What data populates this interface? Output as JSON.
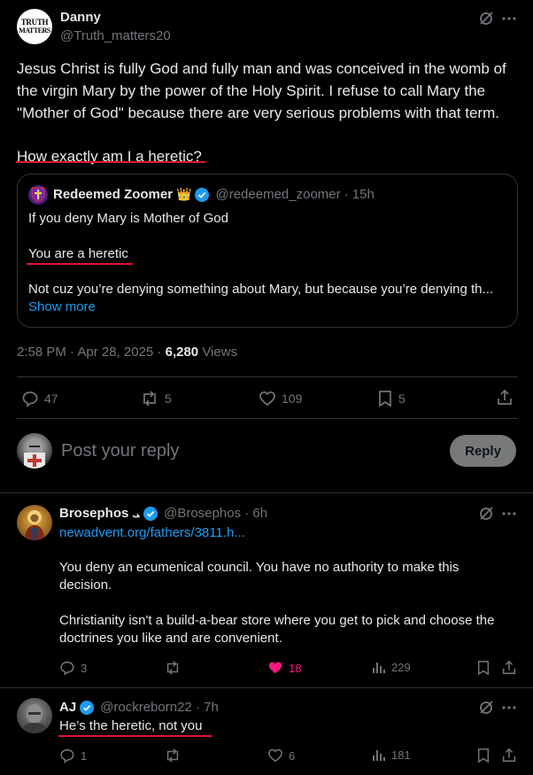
{
  "main_post": {
    "author_name": "Danny",
    "author_handle": "@Truth_matters20",
    "avatar_text_1": "TRUTH",
    "avatar_text_2": "MATTERS",
    "body_line_1": "Jesus Christ is fully God and fully man and was conceived in the womb of",
    "body_line_2": "the virgin Mary by the power of the Holy Spirit. I refuse to call Mary the",
    "body_line_3": "\"Mother of God\" because there are very serious problems with that term.",
    "body_question": "How exactly am I a heretic?",
    "quote": {
      "author_name": "Redeemed Zoomer",
      "crown_emoji": "👑",
      "author_handle": "@redeemed_zoomer",
      "time": "· 15h",
      "line_1": "If you deny Mary is Mother of God",
      "line_2": "You are a heretic",
      "line_3": "Not cuz you’re denying something about Mary, but because you’re denying th...",
      "show_more": "Show more"
    },
    "meta_time": "2:58 PM · Apr 28, 2025 ·",
    "meta_views_count": "6,280",
    "meta_views_label": "Views",
    "actions": {
      "replies": "47",
      "reposts": "5",
      "likes": "109",
      "bookmarks": "5"
    }
  },
  "reply_box": {
    "placeholder": "Post your reply",
    "button_label": "Reply"
  },
  "replies": [
    {
      "author_name": "Brosephos",
      "name_suffix": "ܝ",
      "author_handle": "@Brosephos · 6h",
      "link": "newadvent.org/fathers/3811.h...",
      "para_1_line_1": "You deny an ecumenical council. You have no authority to make this",
      "para_1_line_2": "decision.",
      "para_2_line_1": "Christianity isn't a build-a-bear store where you get to pick and choose the",
      "para_2_line_2": "doctrines you like and are convenient.",
      "replies": "3",
      "likes": "18",
      "views": "229"
    },
    {
      "author_name": "AJ",
      "author_handle": "@rockreborn22 · 7h",
      "text": "He’s the heretic, not you",
      "replies": "1",
      "likes": "6",
      "views": "181"
    }
  ],
  "colors": {
    "background": "#000000",
    "text": "#e7e9ea",
    "muted": "#71767b",
    "link": "#1d9bf0",
    "annotation_red": "#e0142a",
    "like_active": "#f91880",
    "divider": "#2f3336"
  }
}
